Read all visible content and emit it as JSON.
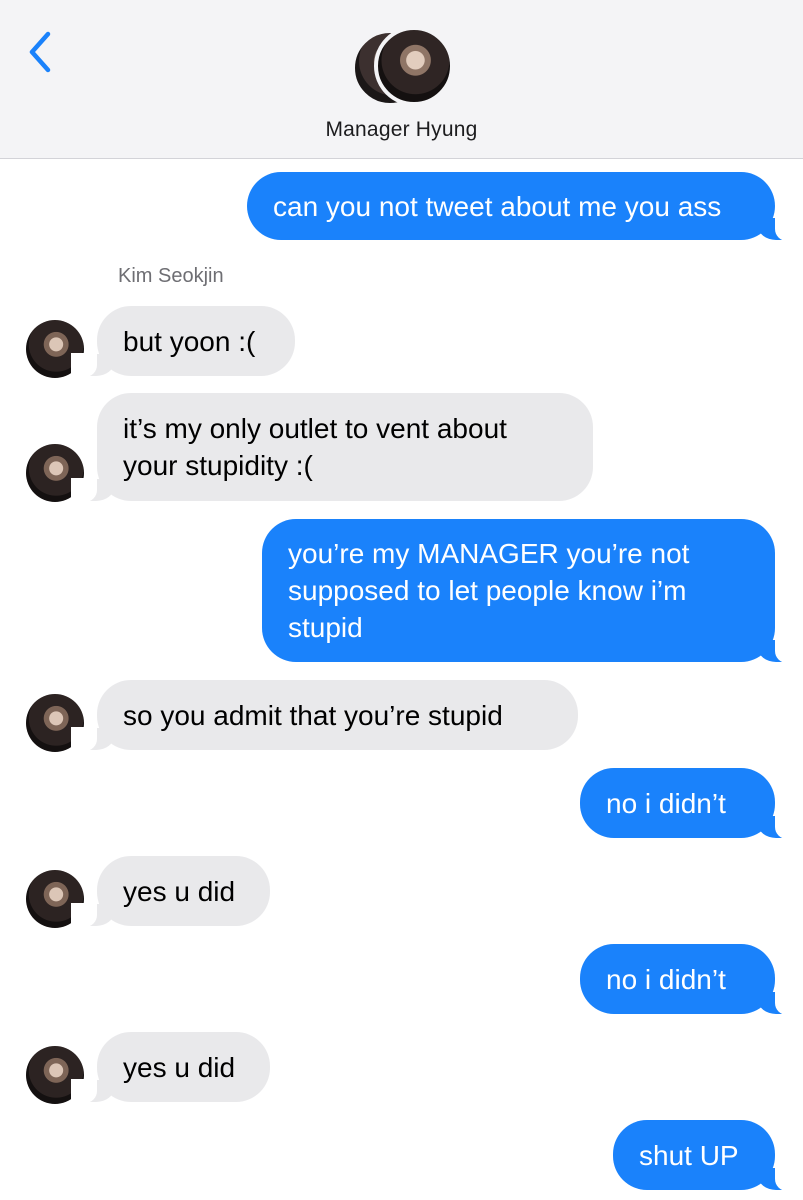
{
  "header": {
    "contact_name": "Manager Hyung",
    "back_icon": "chevron-left-icon",
    "accent_color": "#1a82fb"
  },
  "sender_label": "Kim Seokjin",
  "messages": [
    {
      "from": "me",
      "text": "can you not tweet about me you ass"
    },
    {
      "from": "them",
      "text": "but yoon :("
    },
    {
      "from": "them",
      "text": "it’s my only outlet to vent about your stupidity :("
    },
    {
      "from": "me",
      "text": "you’re my MANAGER you’re not supposed to let people know i’m stupid"
    },
    {
      "from": "them",
      "text": "so you admit that you’re stupid"
    },
    {
      "from": "me",
      "text": "no i didn’t"
    },
    {
      "from": "them",
      "text": "yes u did"
    },
    {
      "from": "me",
      "text": "no i didn’t"
    },
    {
      "from": "them",
      "text": "yes u did"
    },
    {
      "from": "me",
      "text": "shut UP"
    }
  ],
  "colors": {
    "sent_bubble": "#1a82fb",
    "received_bubble": "#e9e9eb",
    "header_bg": "#f4f4f6"
  }
}
